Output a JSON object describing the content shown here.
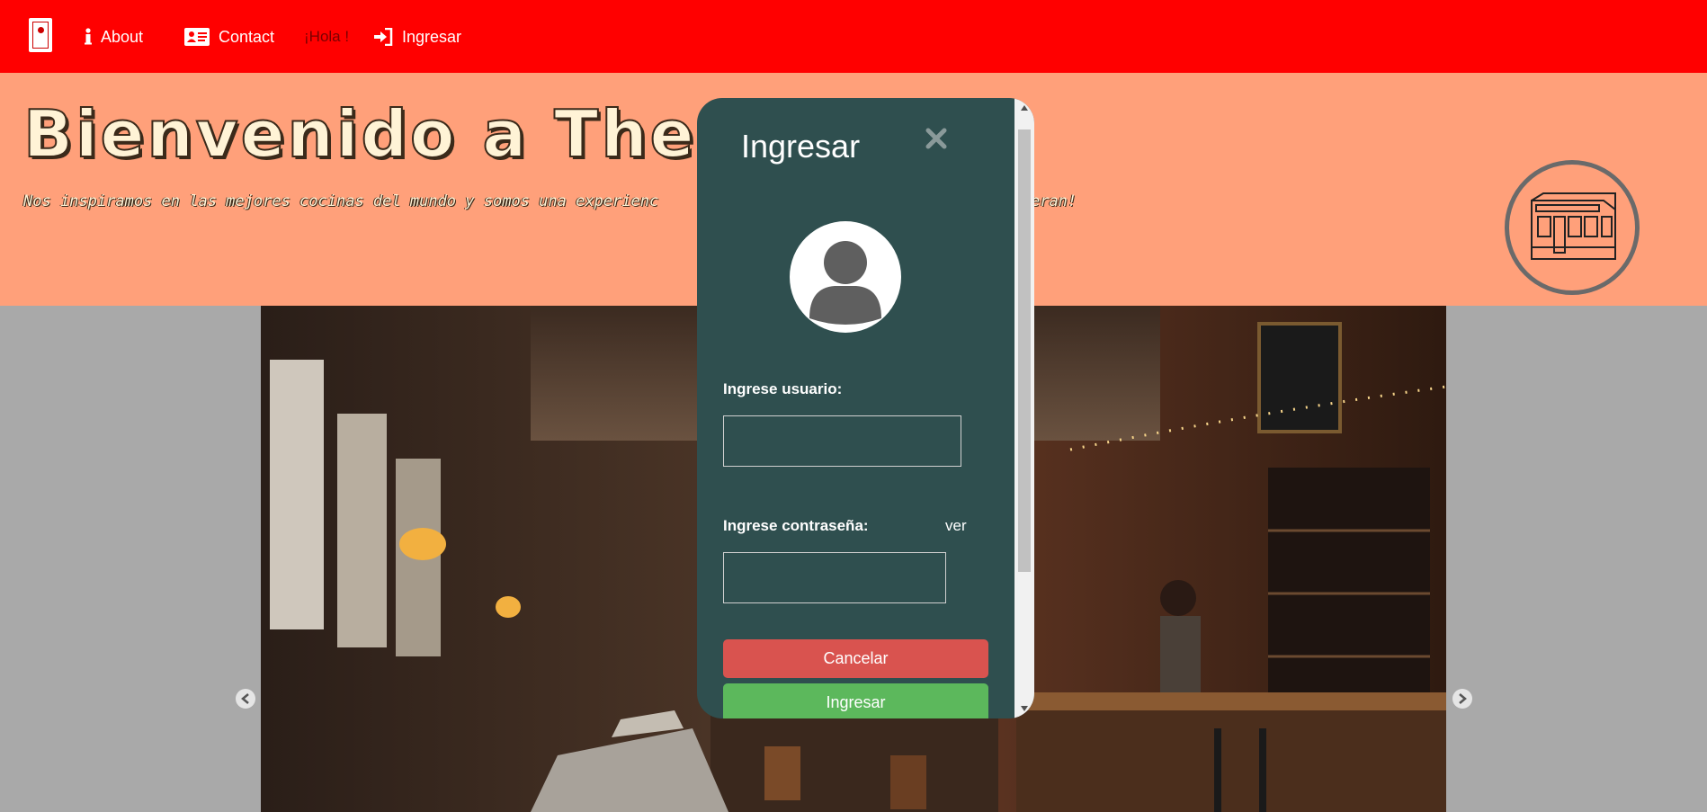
{
  "nav": {
    "about_label": "About",
    "contact_label": "Contact",
    "hola_label": "¡Hola !",
    "login_label": "Ingresar"
  },
  "header": {
    "title": "Bienvenido a The Ten",
    "subtitle": "Nos inspiramos en las mejores cocinas del mundo y somos una experienc",
    "subtitle_tail": "ones te sorprenderan!"
  },
  "modal": {
    "title": "Ingresar",
    "user_label": "Ingrese usuario:",
    "user_value": "",
    "pass_label": "Ingrese contraseña:",
    "pass_value": "",
    "show_label": "ver",
    "cancel_label": "Cancelar",
    "submit_label": "Ingresar"
  },
  "colors": {
    "navbar": "#ff0000",
    "header": "#ffa07a",
    "modal": "#2f4f4f",
    "cancel": "#d9534f",
    "submit": "#5cb85c"
  },
  "icons": {
    "brand": "door-icon",
    "about": "info-icon",
    "contact": "address-card-icon",
    "login": "sign-in-icon",
    "close": "close-icon",
    "avatar": "user-icon",
    "prev": "chevron-left-icon",
    "next": "chevron-right-icon"
  }
}
